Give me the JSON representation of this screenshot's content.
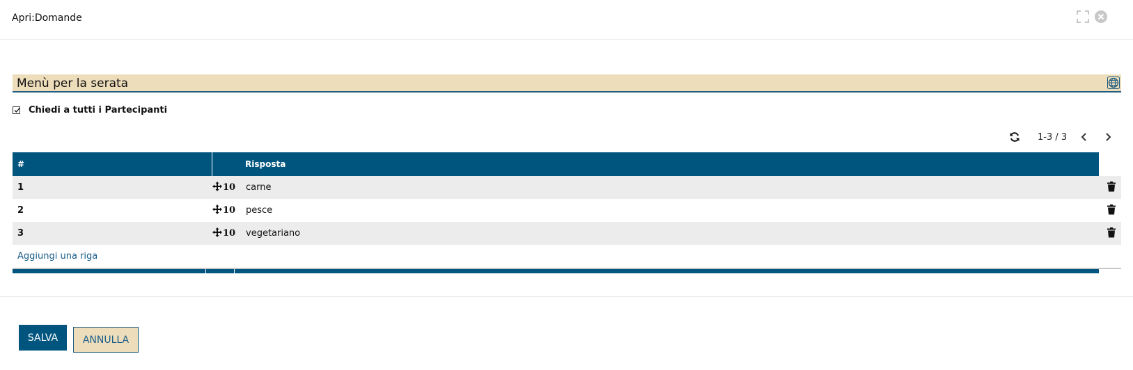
{
  "window": {
    "title": "Apri:Domande",
    "icons": [
      "expand-icon",
      "close-icon"
    ]
  },
  "question": {
    "value": "Menù per la serata",
    "icon": "globe-icon"
  },
  "checkbox": {
    "label": "Chiedi a tutti i Partecipanti",
    "checked": true
  },
  "pager": {
    "range": "1-3 / 3"
  },
  "table": {
    "headers": {
      "num": "#",
      "answer": "Risposta"
    },
    "rows": [
      {
        "num": "1",
        "order": "10",
        "answer": "carne"
      },
      {
        "num": "2",
        "order": "10",
        "answer": "pesce"
      },
      {
        "num": "3",
        "order": "10",
        "answer": "vegetariano"
      }
    ],
    "add_row_label": "Aggiungi una riga"
  },
  "buttons": {
    "save": "SALVA",
    "cancel": "ANNULLA"
  },
  "colors": {
    "primary": "#00557f",
    "field_bg": "#eeddbb",
    "row_alt": "#ececec",
    "link": "#1a5e8a"
  }
}
